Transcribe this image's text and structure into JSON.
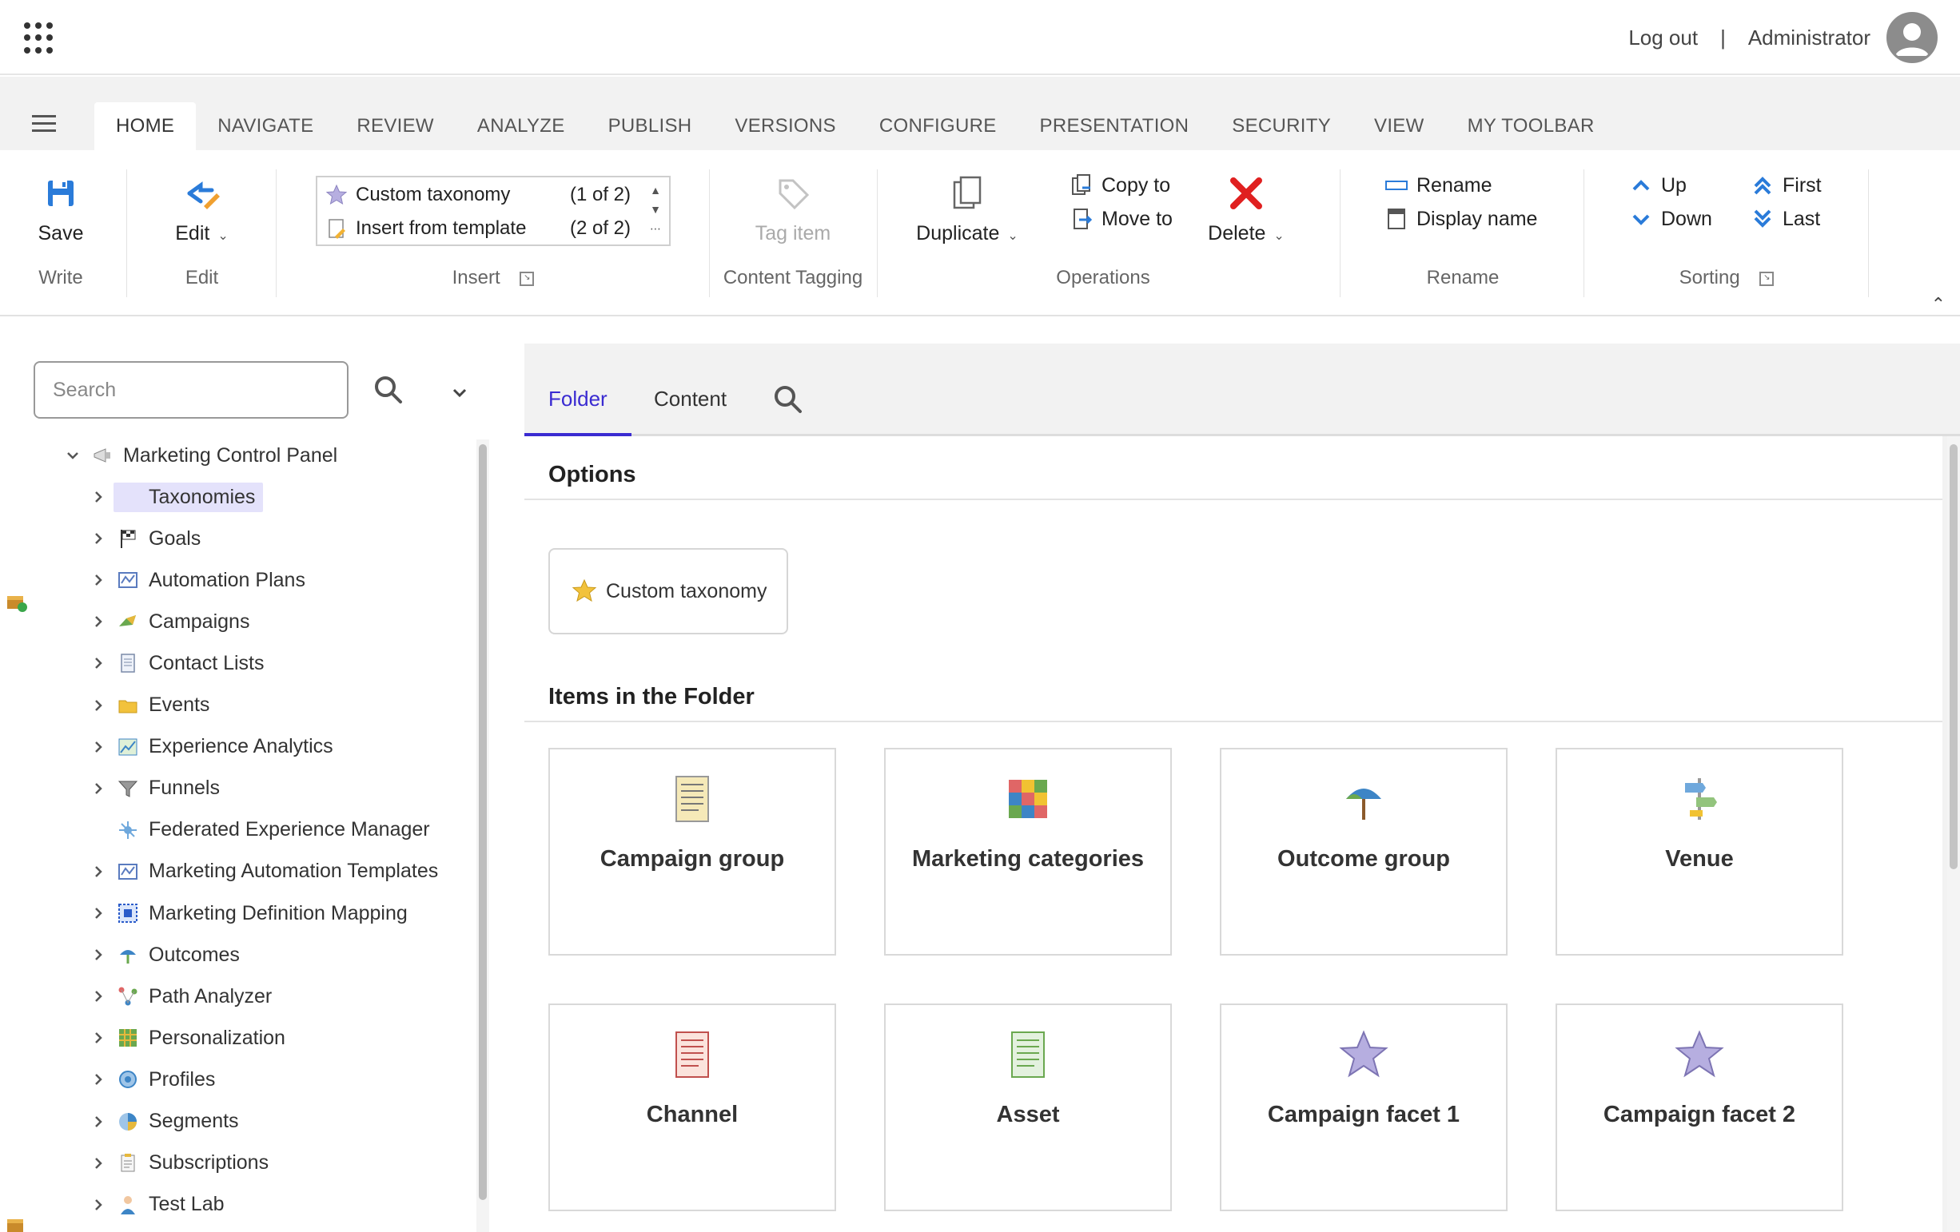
{
  "topbar": {
    "logout_label": "Log out",
    "separator": "|",
    "user_name": "Administrator"
  },
  "ribbon_tabs": [
    "HOME",
    "NAVIGATE",
    "REVIEW",
    "ANALYZE",
    "PUBLISH",
    "VERSIONS",
    "CONFIGURE",
    "PRESENTATION",
    "SECURITY",
    "VIEW",
    "MY TOOLBAR"
  ],
  "active_tab": "HOME",
  "ribbon": {
    "write": {
      "save_label": "Save",
      "group_label": "Write"
    },
    "edit": {
      "edit_label": "Edit",
      "group_label": "Edit"
    },
    "insert": {
      "items": [
        {
          "label": "Custom taxonomy",
          "count": "(1 of 2)"
        },
        {
          "label": "Insert from template",
          "count": "(2 of 2)"
        }
      ],
      "group_label": "Insert"
    },
    "tagging": {
      "tag_label": "Tag item",
      "group_label": "Content Tagging"
    },
    "operations": {
      "duplicate_label": "Duplicate",
      "copy_label": "Copy to",
      "move_label": "Move to",
      "delete_label": "Delete",
      "group_label": "Operations"
    },
    "rename": {
      "rename_label": "Rename",
      "display_name_label": "Display name",
      "group_label": "Rename"
    },
    "sorting": {
      "up_label": "Up",
      "down_label": "Down",
      "first_label": "First",
      "last_label": "Last",
      "group_label": "Sorting"
    }
  },
  "search": {
    "placeholder": "Search"
  },
  "tree": {
    "root": "Marketing Control Panel",
    "items": [
      {
        "label": "Taxonomies",
        "selected": true,
        "icon": "taxonomies-icon"
      },
      {
        "label": "Goals",
        "icon": "goals-flag-icon"
      },
      {
        "label": "Automation Plans",
        "icon": "automation-plans-icon"
      },
      {
        "label": "Campaigns",
        "icon": "campaigns-icon"
      },
      {
        "label": "Contact Lists",
        "icon": "contact-lists-icon"
      },
      {
        "label": "Events",
        "icon": "events-folder-icon"
      },
      {
        "label": "Experience Analytics",
        "icon": "experience-analytics-icon"
      },
      {
        "label": "Funnels",
        "icon": "funnels-icon"
      },
      {
        "label": "Federated Experience Manager",
        "icon": "federated-experience-icon"
      },
      {
        "label": "Marketing Automation Templates",
        "icon": "automation-templates-icon"
      },
      {
        "label": "Marketing Definition Mapping",
        "icon": "definition-mapping-icon"
      },
      {
        "label": "Outcomes",
        "icon": "outcomes-icon"
      },
      {
        "label": "Path Analyzer",
        "icon": "path-analyzer-icon"
      },
      {
        "label": "Personalization",
        "icon": "personalization-icon"
      },
      {
        "label": "Profiles",
        "icon": "profiles-icon"
      },
      {
        "label": "Segments",
        "icon": "segments-icon"
      },
      {
        "label": "Subscriptions",
        "icon": "subscriptions-icon"
      },
      {
        "label": "Test Lab",
        "icon": "test-lab-icon"
      }
    ]
  },
  "content": {
    "tabs": [
      "Folder",
      "Content"
    ],
    "active_tab": "Folder",
    "options_title": "Options",
    "option_button": "Custom taxonomy",
    "items_title": "Items in the Folder",
    "items": [
      {
        "label": "Campaign group",
        "icon": "campaign-group-icon"
      },
      {
        "label": "Marketing categories",
        "icon": "marketing-categories-icon"
      },
      {
        "label": "Outcome group",
        "icon": "outcome-group-icon"
      },
      {
        "label": "Venue",
        "icon": "venue-icon"
      },
      {
        "label": "Channel",
        "icon": "channel-icon"
      },
      {
        "label": "Asset",
        "icon": "asset-icon"
      },
      {
        "label": "Campaign facet 1",
        "icon": "star-icon"
      },
      {
        "label": "Campaign facet 2",
        "icon": "star-icon"
      }
    ]
  },
  "colors": {
    "accent": "#3a2bd1",
    "delete_red": "#e02020",
    "icon_blue": "#2a7bd9",
    "selected_bg": "#e4e2fb"
  }
}
